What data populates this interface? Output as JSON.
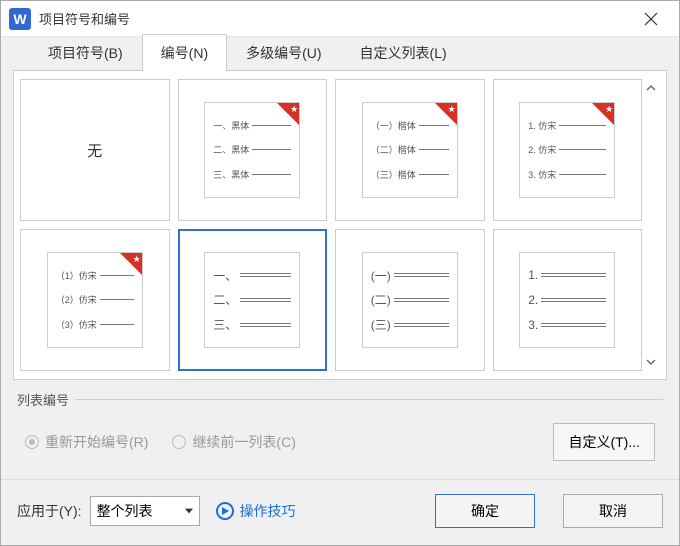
{
  "titlebar": {
    "app_letter": "W",
    "title": "项目符号和编号"
  },
  "tabs": [
    {
      "label": "项目符号(B)",
      "active": false
    },
    {
      "label": "编号(N)",
      "active": true
    },
    {
      "label": "多级编号(U)",
      "active": false
    },
    {
      "label": "自定义列表(L)",
      "active": false
    }
  ],
  "thumbs": [
    {
      "type": "none",
      "label": "无",
      "starred": false
    },
    {
      "type": "labeled",
      "rows": [
        "一、黑体",
        "二、黑体",
        "三、黑体"
      ],
      "starred": true
    },
    {
      "type": "labeled",
      "rows": [
        "（一）楷体",
        "（二）楷体",
        "（三）楷体"
      ],
      "starred": true
    },
    {
      "type": "labeled",
      "rows": [
        "1. 仿宋",
        "2. 仿宋",
        "3. 仿宋"
      ],
      "starred": true
    },
    {
      "type": "labeled",
      "rows": [
        "（1）仿宋",
        "（2）仿宋",
        "（3）仿宋"
      ],
      "starred": true
    },
    {
      "type": "lines",
      "prefixes": [
        "一、",
        "二、",
        "三、"
      ],
      "starred": false,
      "selected": true
    },
    {
      "type": "lines",
      "prefixes": [
        "(一)",
        "(二)",
        "(三)"
      ],
      "starred": false
    },
    {
      "type": "lines",
      "prefixes": [
        "1.",
        "2.",
        "3."
      ],
      "starred": false
    }
  ],
  "list_numbering": {
    "legend": "列表编号",
    "restart_label": "重新开始编号(R)",
    "continue_label": "继续前一列表(C)",
    "customize_label": "自定义(T)..."
  },
  "bottom": {
    "apply_label": "应用于(Y):",
    "select_value": "整个列表",
    "tips_label": "操作技巧",
    "ok_label": "确定",
    "cancel_label": "取消"
  }
}
